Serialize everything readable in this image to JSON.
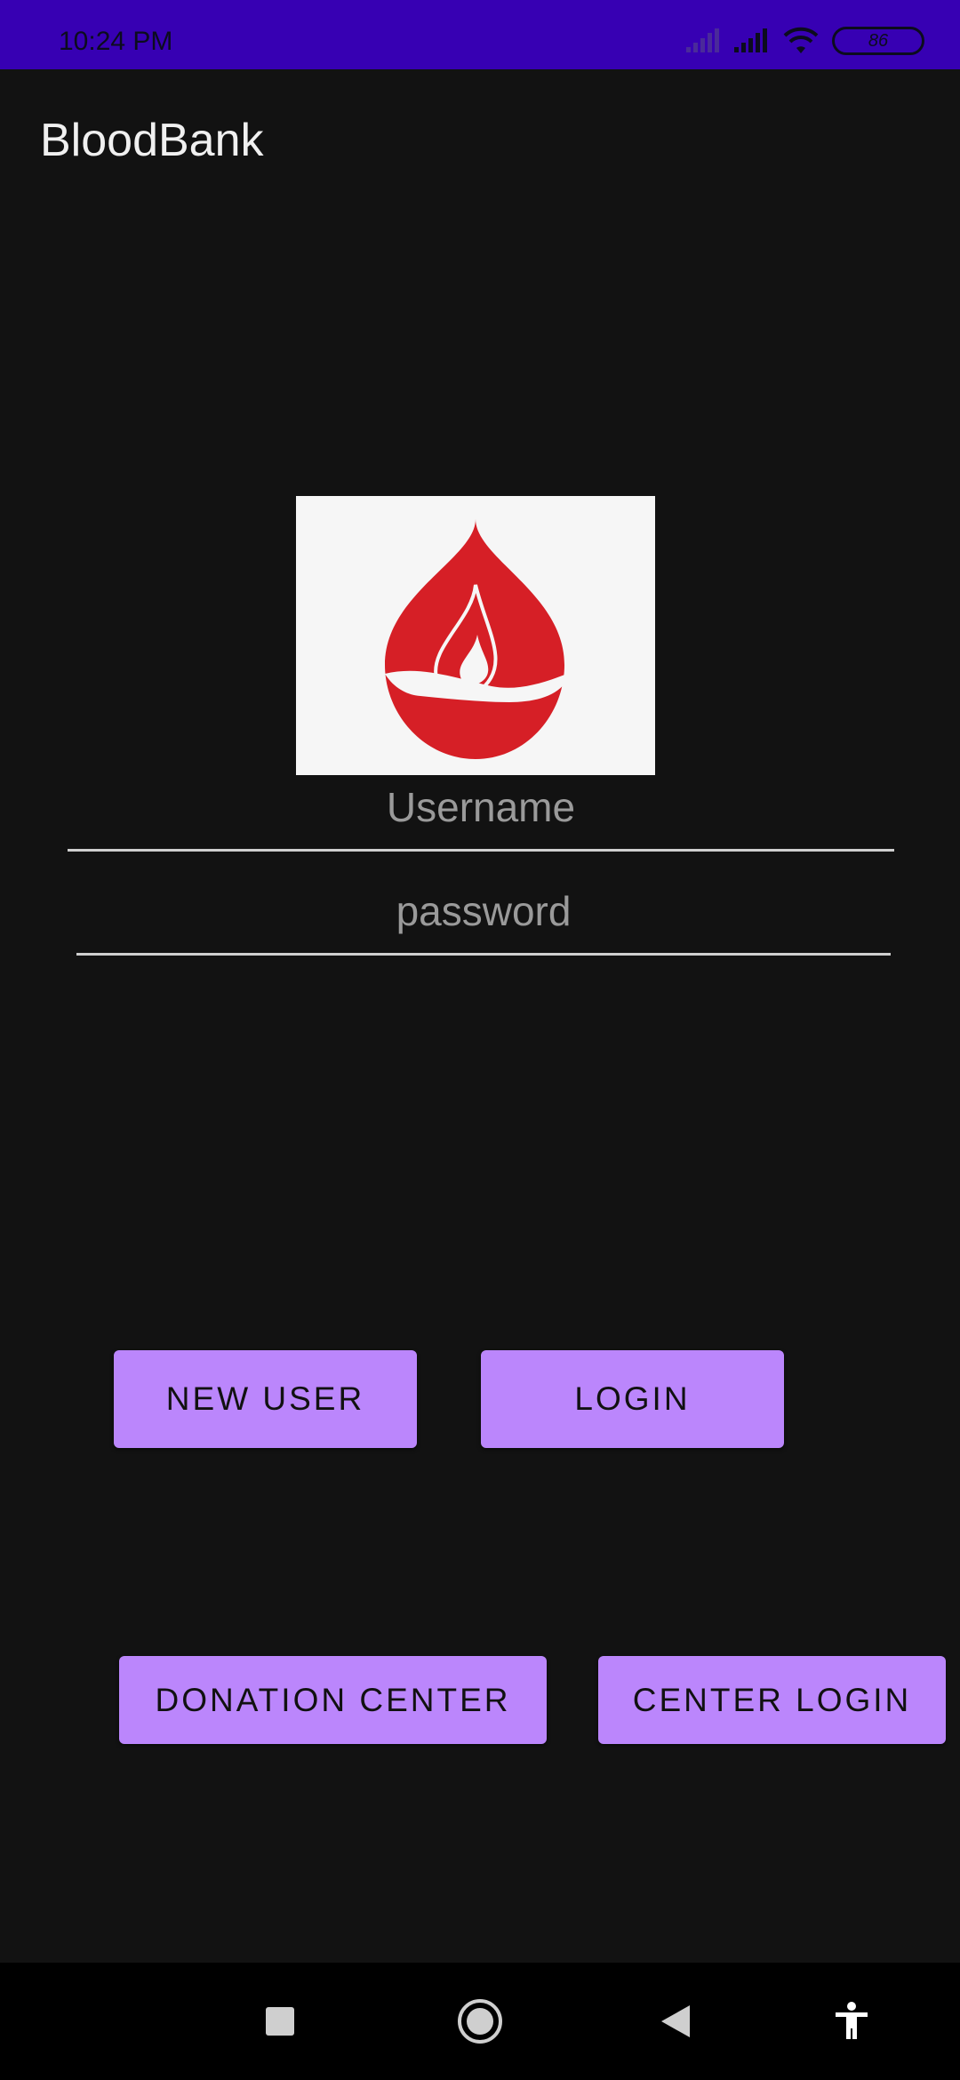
{
  "status_bar": {
    "time": "10:24 PM",
    "battery_level": "86",
    "icons": [
      "signal-weak-icon",
      "signal-icon",
      "wifi-icon",
      "battery-icon"
    ]
  },
  "app_bar": {
    "title": "BloodBank"
  },
  "logo": {
    "icon": "blood-drop-hand-icon",
    "colors": {
      "drop": "#d61f26",
      "background": "#f6f6f6"
    }
  },
  "form": {
    "username_placeholder": "Username",
    "password_placeholder": "password"
  },
  "buttons": {
    "new_user": "NEW USER",
    "login": "LOGIN",
    "donation_center": "DONATION CENTER",
    "center_login": "CENTER LOGIN"
  },
  "nav_bar": {
    "icons": [
      "recents-square-icon",
      "home-circle-icon",
      "back-triangle-icon",
      "accessibility-icon"
    ]
  },
  "colors": {
    "status_bar": "#3700b3",
    "background": "#121212",
    "button": "#bb86fc"
  }
}
